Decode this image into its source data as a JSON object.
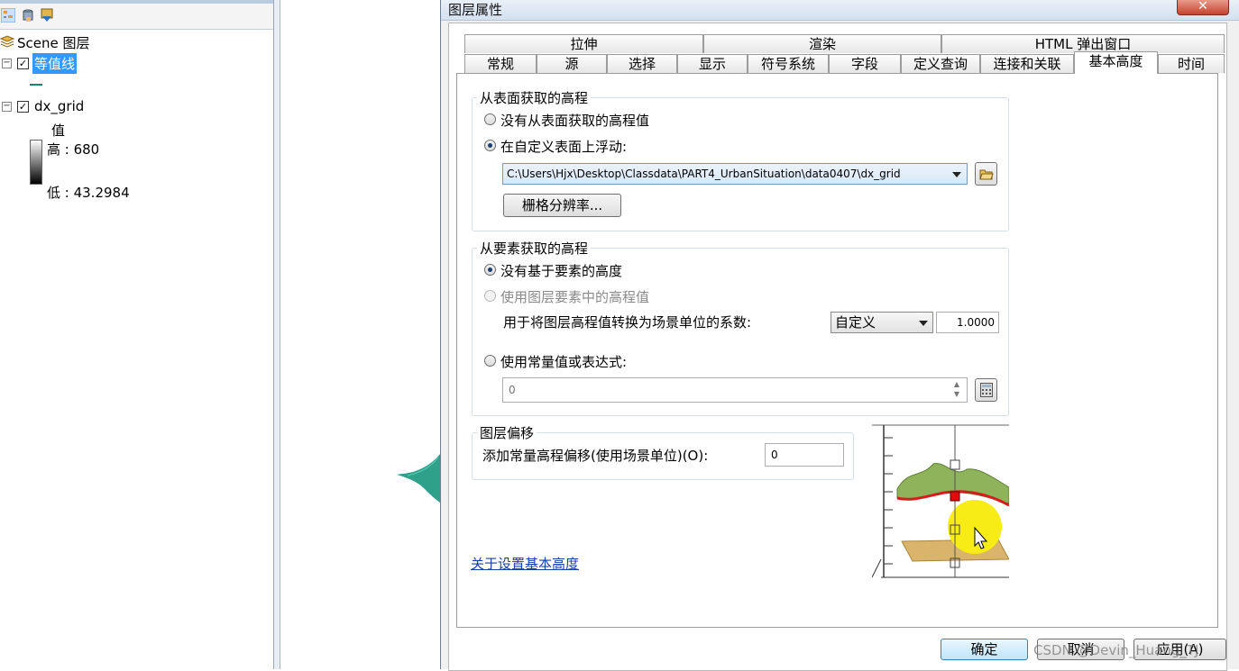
{
  "toc": {
    "root_label": "Scene 图层",
    "layer1_label": "等值线",
    "layer2_label": "dx_grid",
    "legend_title": "值",
    "legend_high": "高 : 680",
    "legend_low": "低 : 43.2984"
  },
  "dialog": {
    "title": "图层属性",
    "close_label": "✕",
    "tabs_row1": [
      "拉伸",
      "渲染",
      "HTML 弹出窗口"
    ],
    "tabs_row2": [
      "常规",
      "源",
      "选择",
      "显示",
      "符号系统",
      "字段",
      "定义查询",
      "连接和关联",
      "基本高度",
      "时间"
    ],
    "active_tab": "基本高度"
  },
  "surface": {
    "group_title": "从表面获取的高程",
    "option_none": "没有从表面获取的高程值",
    "option_float": "在自定义表面上浮动:",
    "surface_path": "C:\\Users\\Hjx\\Desktop\\Classdata\\PART4_UrbanSituation\\data0407\\dx_grid",
    "raster_button": "栅格分辨率..."
  },
  "features": {
    "group_title": "从要素获取的高程",
    "option_none": "没有基于要素的高度",
    "option_layer": "使用图层要素中的高程值",
    "conversion_label": "用于将图层高程值转换为场景单位的系数:",
    "conversion_unit": "自定义",
    "conversion_factor": "1.0000",
    "option_expression": "使用常量值或表达式:",
    "expression_value": "0"
  },
  "offset": {
    "group_title": "图层偏移",
    "offset_label": "添加常量高程偏移(使用场景单位)(O):",
    "offset_value": "0"
  },
  "help_link": "关于设置基本高度",
  "buttons": {
    "ok": "确定",
    "cancel": "取消",
    "apply": "应用(A)"
  },
  "watermark": "CSDN @Devin_Huang_TJ",
  "colors": {
    "selection_blue": "#3399ff",
    "contour_line": "#0a8a6f",
    "link": "#1a3ea8"
  }
}
